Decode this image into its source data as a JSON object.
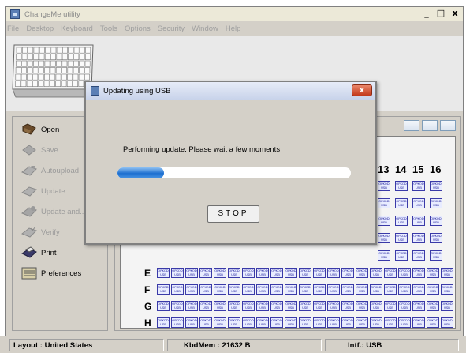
{
  "app": {
    "title": "ChangeMe utility",
    "controls": [
      "_",
      "□",
      "x"
    ]
  },
  "menu": [
    "File",
    "Desktop",
    "Keyboard",
    "Tools",
    "Options",
    "Security",
    "Window",
    "Help"
  ],
  "sidebar": {
    "items": [
      {
        "label": "Open",
        "icon": "folder-open-icon",
        "enabled": true
      },
      {
        "label": "Save",
        "icon": "save-icon",
        "enabled": false
      },
      {
        "label": "Autoupload",
        "icon": "upload-icon",
        "enabled": false
      },
      {
        "label": "Update",
        "icon": "update-icon",
        "enabled": false
      },
      {
        "label": "Update and...",
        "icon": "update-and-icon",
        "enabled": false
      },
      {
        "label": "Verify",
        "icon": "verify-icon",
        "enabled": false
      },
      {
        "label": "Print",
        "icon": "print-icon",
        "enabled": true
      },
      {
        "label": "Preferences",
        "icon": "preferences-icon",
        "enabled": true
      }
    ]
  },
  "grid": {
    "columns": [
      "13",
      "14",
      "15",
      "16"
    ],
    "rows": [
      "E",
      "F",
      "G",
      "H"
    ],
    "cell_text": "OPKOD USB"
  },
  "status": {
    "layout": "Layout : United States",
    "mem": "KbdMem : 21632 B",
    "intf": "Intf.: USB"
  },
  "dialog": {
    "title": "Updating using USB",
    "close": "x",
    "message": "Performing update. Please wait a few moments.",
    "progress": 0.2,
    "stop_label": "STOP"
  },
  "colors": {
    "progress": "#1d6fd0",
    "close_button": "#c2391b",
    "cell_border": "#3a3aa8"
  }
}
